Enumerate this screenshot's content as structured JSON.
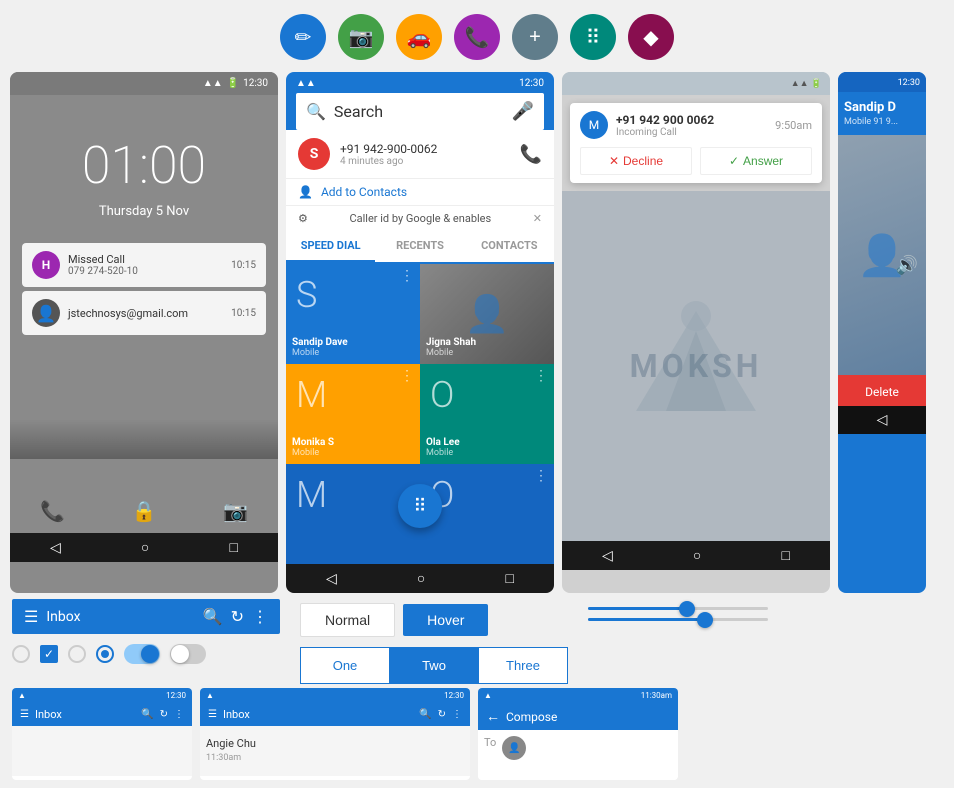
{
  "topIcons": [
    {
      "name": "pencil-icon",
      "symbol": "✏",
      "color": "#1976D2"
    },
    {
      "name": "camera-icon",
      "symbol": "📷",
      "color": "#43a047"
    },
    {
      "name": "car-icon",
      "symbol": "🚗",
      "color": "#FFA000"
    },
    {
      "name": "phone-icon",
      "symbol": "📞",
      "color": "#9C27B0"
    },
    {
      "name": "plus-icon",
      "symbol": "+",
      "color": "#607D8B"
    },
    {
      "name": "grid-icon",
      "symbol": "⠿",
      "color": "#00897B"
    },
    {
      "name": "diamond-icon",
      "symbol": "◆",
      "color": "#880E4F"
    }
  ],
  "screen1": {
    "time": "01:00",
    "date": "Thursday 5 Nov",
    "notifications": [
      {
        "id": "n1",
        "type": "Missed Call",
        "detail": "079 274-520-10",
        "time": "10:15",
        "avatarColor": "#9C27B0",
        "avatarLetter": "H"
      },
      {
        "id": "n2",
        "type": "jstechnosys@gmail.com",
        "detail": "",
        "time": "10:15",
        "avatarColor": "#555",
        "avatarLetter": ""
      }
    ]
  },
  "screen2": {
    "statusTime": "12:30",
    "searchPlaceholder": "Search",
    "contactSuggestion": {
      "number": "+91 942-900-0062",
      "subtext": "4 minutes ago",
      "avatarLetter": "S",
      "avatarColor": "#e53935"
    },
    "addToContacts": "Add to Contacts",
    "callerIdText": "Caller id by Google & enables",
    "tabs": [
      "SPEED DIAL",
      "RECENTS",
      "CONTACTS"
    ],
    "activeTab": "SPEED DIAL",
    "speedDial": [
      {
        "letter": "S",
        "name": "Sandip Dave",
        "sub": "Mobile",
        "bg": "#1976D2"
      },
      {
        "type": "photo",
        "name": "Jigna Shah",
        "sub": "Mobile"
      },
      {
        "letter": "M",
        "name": "Monika S",
        "sub": "Mobile",
        "bg": "#FFA000"
      },
      {
        "letter": "O",
        "name": "Ola Lee",
        "sub": "Mobile",
        "bg": "#00897B"
      },
      {
        "letter": "M",
        "name": "",
        "sub": "",
        "bg": "#1565C0"
      },
      {
        "letter": "O",
        "name": "",
        "sub": "",
        "bg": "#1565C0"
      }
    ]
  },
  "screen3": {
    "incomingNumber": "+91 942 900 0062",
    "incomingLabel": "Incoming Call",
    "incomingTime": "9:50am",
    "avatarLetter": "M",
    "declineLabel": "Decline",
    "answerLabel": "Answer",
    "brandText": "MOKSH"
  },
  "screen4": {
    "name": "Sandip D",
    "sub": "Mobile 91 9...",
    "volIcon": "🔊"
  },
  "bottomUI": {
    "inboxLabel": "Inbox",
    "normalLabel": "Normal",
    "hoverLabel": "Hover",
    "segButtons": [
      "One",
      "Two",
      "Three"
    ],
    "slider1": {
      "fill": 55,
      "knobPos": 55
    },
    "slider2": {
      "fill": 65,
      "knobPos": 65
    }
  },
  "bottomScreens": {
    "screen1": {
      "statusTime": "12:30",
      "inboxLabel": "Inbox"
    },
    "screen2": {
      "statusTime": "12:30",
      "inboxLabel": "Inbox",
      "contact": "Angie Chu"
    },
    "screen3": {
      "statusTime": "11:30am",
      "composeLabel": "Compose",
      "toLabel": "To"
    }
  }
}
